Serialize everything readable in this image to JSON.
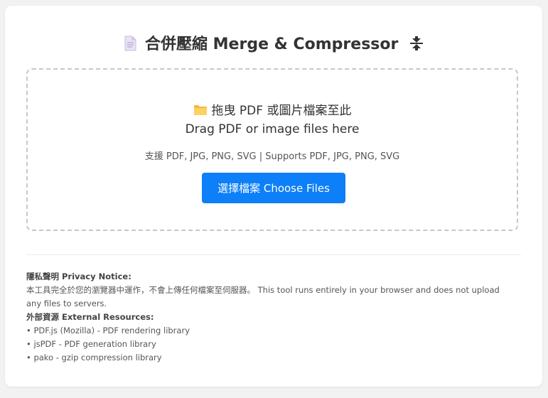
{
  "header": {
    "title_zh": "合併壓縮",
    "title_en": "Merge & Compressor",
    "left_icon": "document-icon",
    "right_icon": "compress-icon"
  },
  "dropzone": {
    "icon": "folder-icon",
    "heading_zh": "拖曳 PDF 或圖片檔案至此",
    "heading_en": "Drag PDF or image files here",
    "supports": "支援 PDF, JPG, PNG, SVG | Supports PDF, JPG, PNG, SVG",
    "button_label": "選擇檔案 Choose Files"
  },
  "footer": {
    "privacy_title": "隱私聲明 Privacy Notice:",
    "privacy_text": "本工具完全於您的瀏覽器中運作，不會上傳任何檔案至伺服器。 This tool runs entirely in your browser and does not upload any files to servers.",
    "resources_title": "外部資源 External Resources:",
    "resources": [
      "• PDF.js (Mozilla) - PDF rendering library",
      "• jsPDF - PDF generation library",
      "• pako - gzip compression library"
    ]
  },
  "colors": {
    "accent": "#0d7ff8",
    "background": "#f2f2f2",
    "card": "#ffffff",
    "dashed_border": "#c8c8c8"
  }
}
